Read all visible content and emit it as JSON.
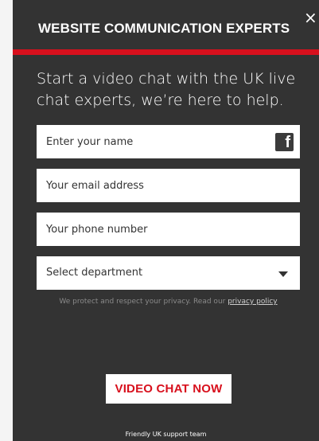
{
  "header": {
    "title": "WEBSITE COMMUNICATION EXPERTS",
    "close_glyph": "×"
  },
  "intro": "Start a video chat with the UK live chat experts, we’re here to help.",
  "form": {
    "name_placeholder": "Enter your name",
    "email_placeholder": "Your email address",
    "phone_placeholder": "Your phone number",
    "department_selected": "Select department"
  },
  "privacy": {
    "text": "We protect and respect your privacy. Read our ",
    "link_label": "privacy policy"
  },
  "cta_label": "VIDEO CHAT NOW",
  "footer_text": "Friendly UK support team",
  "icons": {
    "facebook_glyph": "f"
  },
  "colors": {
    "panel": "#333333",
    "accent": "#d8101d",
    "text": "#ffffff"
  }
}
